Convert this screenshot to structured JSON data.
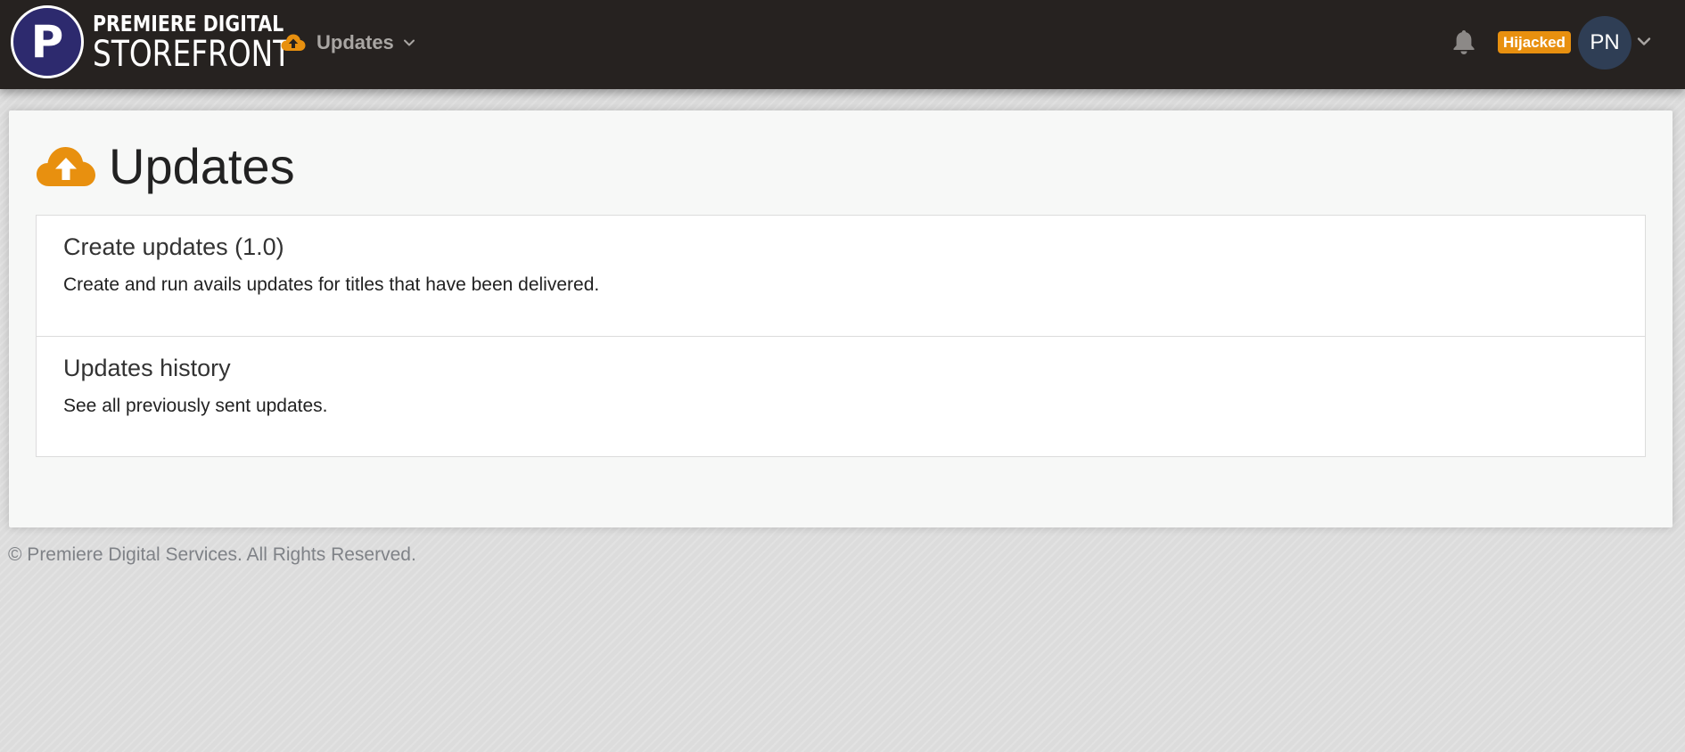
{
  "brand": {
    "logo_letter": "P",
    "line1": "PREMIERE DIGITAL",
    "line2": "STOREFRONT"
  },
  "nav": {
    "menu_label": "Updates",
    "menu_icon": "cloud-upload-icon"
  },
  "header_right": {
    "notification_icon": "bell-icon",
    "badge_label": "Hijacked",
    "avatar_initials": "PN"
  },
  "page": {
    "title": "Updates",
    "title_icon": "cloud-upload-icon",
    "items": [
      {
        "title": "Create updates (1.0)",
        "description": "Create and run avails updates for titles that have been delivered."
      },
      {
        "title": "Updates history",
        "description": "See all previously sent updates."
      }
    ]
  },
  "footer": {
    "copyright": "© Premiere Digital Services. All Rights Reserved."
  },
  "colors": {
    "navbar": "#262220",
    "accent_orange": "#e8900f",
    "avatar_bg": "#2f3e55",
    "logo_bg": "#2d2a6e"
  }
}
